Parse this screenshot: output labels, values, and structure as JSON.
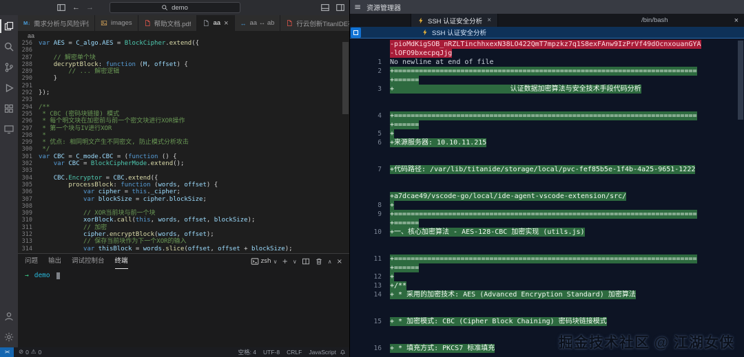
{
  "left_window": {
    "title_bar": {
      "command_center": "demo"
    },
    "activity_bar": {
      "top": [
        "files",
        "search",
        "source-control",
        "run-debug",
        "extensions",
        "remote"
      ],
      "bottom": [
        "account",
        "settings-gear"
      ]
    },
    "tabs": [
      {
        "label": "需求分析与风险评估.md",
        "icon": "markdown",
        "active": false
      },
      {
        "label": "images",
        "icon": "image",
        "active": false
      },
      {
        "label": "帮助文档.pdf",
        "icon": "pdf",
        "active": false
      },
      {
        "label": "aa",
        "icon": "file",
        "active": true
      },
      {
        "label": "aa ↔ ab",
        "icon": "diff",
        "active": false
      },
      {
        "label": "行云创新TitanIDE在数据要...",
        "icon": "pdf",
        "active": false
      }
    ],
    "breadcrumb": "aa",
    "editor_lines": [
      {
        "n": "256",
        "t": [
          [
            "kw",
            "var "
          ],
          [
            "vb",
            "AES"
          ],
          [
            "pl",
            " = "
          ],
          [
            "vb",
            "C_algo"
          ],
          [
            "pl",
            "."
          ],
          [
            "vb",
            "AES"
          ],
          [
            "pl",
            " = "
          ],
          [
            "cl",
            "BlockCipher"
          ],
          [
            "pl",
            "."
          ],
          [
            "fn",
            "extend"
          ],
          [
            "pl",
            "({"
          ]
        ]
      },
      {
        "n": "286",
        "t": []
      },
      {
        "n": "287",
        "t": [
          [
            "cm",
            "    // 解密单个块"
          ]
        ]
      },
      {
        "n": "288",
        "t": [
          [
            "pl",
            "    "
          ],
          [
            "fn",
            "decryptBlock"
          ],
          [
            "pl",
            ": "
          ],
          [
            "kw",
            "function"
          ],
          [
            "pl",
            " ("
          ],
          [
            "vb",
            "M"
          ],
          [
            "pl",
            ", "
          ],
          [
            "vb",
            "offset"
          ],
          [
            "pl",
            ") {"
          ]
        ]
      },
      {
        "n": "289",
        "t": [
          [
            "cm",
            "        // ... 解密逻辑"
          ]
        ]
      },
      {
        "n": "290",
        "t": [
          [
            "pl",
            "    }"
          ]
        ]
      },
      {
        "n": "291",
        "t": []
      },
      {
        "n": "292",
        "t": [
          [
            "pl",
            "});"
          ]
        ]
      },
      {
        "n": "293",
        "t": []
      },
      {
        "n": "294",
        "t": [
          [
            "cm",
            "/**"
          ]
        ]
      },
      {
        "n": "295",
        "t": [
          [
            "cm",
            " * CBC (密码块链接) 模式"
          ]
        ]
      },
      {
        "n": "296",
        "t": [
          [
            "cm",
            " * 每个明文块在加密前与前一个密文块进行XOR操作"
          ]
        ]
      },
      {
        "n": "297",
        "t": [
          [
            "cm",
            " * 第一个块与IV进行XOR"
          ]
        ]
      },
      {
        "n": "298",
        "t": [
          [
            "cm",
            " *"
          ]
        ]
      },
      {
        "n": "299",
        "t": [
          [
            "cm",
            " * 优点: 相同明文产生不同密文, 防止模式分析攻击"
          ]
        ]
      },
      {
        "n": "300",
        "t": [
          [
            "cm",
            " */"
          ]
        ]
      },
      {
        "n": "301",
        "t": [
          [
            "kw",
            "var "
          ],
          [
            "vb",
            "CBC"
          ],
          [
            "pl",
            " = "
          ],
          [
            "vb",
            "C_mode"
          ],
          [
            "pl",
            "."
          ],
          [
            "vb",
            "CBC"
          ],
          [
            "pl",
            " = ("
          ],
          [
            "kw",
            "function"
          ],
          [
            "pl",
            " () {"
          ]
        ]
      },
      {
        "n": "302",
        "t": [
          [
            "pl",
            "    "
          ],
          [
            "kw",
            "var "
          ],
          [
            "vb",
            "CBC"
          ],
          [
            "pl",
            " = "
          ],
          [
            "cl",
            "BlockCipherMode"
          ],
          [
            "pl",
            "."
          ],
          [
            "fn",
            "extend"
          ],
          [
            "pl",
            "();"
          ]
        ]
      },
      {
        "n": "303",
        "t": []
      },
      {
        "n": "304",
        "t": [
          [
            "pl",
            "    "
          ],
          [
            "vb",
            "CBC"
          ],
          [
            "pl",
            "."
          ],
          [
            "cl",
            "Encryptor"
          ],
          [
            "pl",
            " = "
          ],
          [
            "vb",
            "CBC"
          ],
          [
            "pl",
            "."
          ],
          [
            "fn",
            "extend"
          ],
          [
            "pl",
            "({"
          ]
        ]
      },
      {
        "n": "305",
        "t": [
          [
            "pl",
            "        "
          ],
          [
            "fn",
            "processBlock"
          ],
          [
            "pl",
            ": "
          ],
          [
            "kw",
            "function"
          ],
          [
            "pl",
            " ("
          ],
          [
            "vb",
            "words"
          ],
          [
            "pl",
            ", "
          ],
          [
            "vb",
            "offset"
          ],
          [
            "pl",
            ") {"
          ]
        ]
      },
      {
        "n": "306",
        "t": [
          [
            "pl",
            "            "
          ],
          [
            "kw",
            "var "
          ],
          [
            "vb",
            "cipher"
          ],
          [
            "pl",
            " = "
          ],
          [
            "kw",
            "this"
          ],
          [
            "pl",
            "."
          ],
          [
            "vb",
            "_cipher"
          ],
          [
            "pl",
            ";"
          ]
        ]
      },
      {
        "n": "307",
        "t": [
          [
            "pl",
            "            "
          ],
          [
            "kw",
            "var "
          ],
          [
            "vb",
            "blockSize"
          ],
          [
            "pl",
            " = "
          ],
          [
            "vb",
            "cipher"
          ],
          [
            "pl",
            "."
          ],
          [
            "vb",
            "blockSize"
          ],
          [
            "pl",
            ";"
          ]
        ]
      },
      {
        "n": "308",
        "t": []
      },
      {
        "n": "309",
        "t": [
          [
            "cm",
            "            // XOR当前块与前一个块"
          ]
        ]
      },
      {
        "n": "310",
        "t": [
          [
            "pl",
            "            "
          ],
          [
            "vb",
            "xorBlock"
          ],
          [
            "pl",
            "."
          ],
          [
            "fn",
            "call"
          ],
          [
            "pl",
            "("
          ],
          [
            "kw",
            "this"
          ],
          [
            "pl",
            ", "
          ],
          [
            "vb",
            "words"
          ],
          [
            "pl",
            ", "
          ],
          [
            "vb",
            "offset"
          ],
          [
            "pl",
            ", "
          ],
          [
            "vb",
            "blockSize"
          ],
          [
            "pl",
            ");"
          ]
        ]
      },
      {
        "n": "311",
        "t": [
          [
            "cm",
            "            // 加密"
          ]
        ]
      },
      {
        "n": "312",
        "t": [
          [
            "pl",
            "            "
          ],
          [
            "vb",
            "cipher"
          ],
          [
            "pl",
            "."
          ],
          [
            "fn",
            "encryptBlock"
          ],
          [
            "pl",
            "("
          ],
          [
            "vb",
            "words"
          ],
          [
            "pl",
            ", "
          ],
          [
            "vb",
            "offset"
          ],
          [
            "pl",
            ");"
          ]
        ]
      },
      {
        "n": "313",
        "t": [
          [
            "cm",
            "            // 保存当前块作为下一个XOR的输入"
          ]
        ]
      },
      {
        "n": "314",
        "t": [
          [
            "pl",
            "            "
          ],
          [
            "kw",
            "var "
          ],
          [
            "vb",
            "thisBlock"
          ],
          [
            "pl",
            " = "
          ],
          [
            "vb",
            "words"
          ],
          [
            "pl",
            "."
          ],
          [
            "fn",
            "slice"
          ],
          [
            "pl",
            "("
          ],
          [
            "vb",
            "offset"
          ],
          [
            "pl",
            ", "
          ],
          [
            "vb",
            "offset"
          ],
          [
            "pl",
            " + "
          ],
          [
            "vb",
            "blockSize"
          ],
          [
            "pl",
            ");"
          ]
        ]
      }
    ],
    "panel": {
      "tabs": [
        {
          "label": "问题",
          "active": false
        },
        {
          "label": "输出",
          "active": false
        },
        {
          "label": "调试控制台",
          "active": false
        },
        {
          "label": "终端",
          "active": true
        }
      ],
      "shell_selector": "zsh",
      "terminal_prompt": "→",
      "terminal_cwd": "demo"
    },
    "status_bar": {
      "errors": "0",
      "warnings": "0",
      "right_items": [
        "空格: 4",
        "UTF-8",
        "CRLF",
        "JavaScript"
      ]
    }
  },
  "right_window": {
    "menu_title": "资源管理器",
    "editor_tab": {
      "label": "SSH 认证安全分析",
      "shell": "/bin/bash"
    },
    "terminal_tab": {
      "label": "SSH 认证安全分析"
    },
    "diff_rows": [
      {
        "n": "",
        "type": "del",
        "text": "-pioMdKigSOB_nRZLTinchhxexN38LO422QmT7mpzkz7q1S8exFAnw9IzPrVf49dOcnxouanGYA"
      },
      {
        "n": "",
        "type": "del",
        "text": "-lOFO9bxecpqJjg"
      },
      {
        "n": "1",
        "type": "plain",
        "text": "No newline at end of file"
      },
      {
        "n": "2",
        "type": "add",
        "text": "+========================================================================="
      },
      {
        "n": "",
        "type": "add",
        "text": "+======"
      },
      {
        "n": "3",
        "type": "add",
        "text": "+                            认证数据加密算法与安全技术手段代码分析"
      },
      {
        "n": "",
        "type": "gap",
        "text": ""
      },
      {
        "n": "",
        "type": "gap",
        "text": ""
      },
      {
        "n": "4",
        "type": "add",
        "text": "+========================================================================="
      },
      {
        "n": "",
        "type": "add",
        "text": "+======"
      },
      {
        "n": "5",
        "type": "add",
        "text": "+"
      },
      {
        "n": "6",
        "type": "add",
        "text": "+来源服务器: 10.10.11.215"
      },
      {
        "n": "",
        "type": "gap",
        "text": ""
      },
      {
        "n": "",
        "type": "gap",
        "text": ""
      },
      {
        "n": "7",
        "type": "add",
        "text": "+代码路径: /var/lib/titanide/storage/local/pvc-fef85b5e-1f4b-4a25-9651-1222"
      },
      {
        "n": "",
        "type": "gap",
        "text": ""
      },
      {
        "n": "",
        "type": "gap",
        "text": ""
      },
      {
        "n": "",
        "type": "add",
        "text": "+a7dcae49/vscode-go/local/ide-agent-vscode-extension/src/"
      },
      {
        "n": "8",
        "type": "add",
        "text": "+"
      },
      {
        "n": "9",
        "type": "add",
        "text": "+========================================================================="
      },
      {
        "n": "",
        "type": "add",
        "text": "+======"
      },
      {
        "n": "10",
        "type": "add",
        "text": "+一、核心加密算法 - AES-128-CBC 加密实现 (utils.js)"
      },
      {
        "n": "",
        "type": "gap",
        "text": ""
      },
      {
        "n": "",
        "type": "gap",
        "text": ""
      },
      {
        "n": "11",
        "type": "add",
        "text": "+========================================================================="
      },
      {
        "n": "",
        "type": "add",
        "text": "+======"
      },
      {
        "n": "12",
        "type": "add",
        "text": "+"
      },
      {
        "n": "13",
        "type": "add",
        "text": "+/**"
      },
      {
        "n": "14",
        "type": "add",
        "text": "+ * 采用的加密技术: AES (Advanced Encryption Standard) 加密算法"
      },
      {
        "n": "",
        "type": "gap",
        "text": ""
      },
      {
        "n": "",
        "type": "gap",
        "text": ""
      },
      {
        "n": "15",
        "type": "add",
        "text": "+ * 加密模式: CBC (Cipher Block Chaining) 密码块链接模式"
      },
      {
        "n": "",
        "type": "gap",
        "text": ""
      },
      {
        "n": "",
        "type": "gap",
        "text": ""
      },
      {
        "n": "16",
        "type": "add",
        "text": "+ * 填充方式: PKCS7 标准填充"
      }
    ],
    "watermark": "掘金技术社区 @ 江湖女侠"
  },
  "colors": {
    "addition_bg": "#2d6a3f",
    "deletion_bg": "#a81c38",
    "accent_blue": "#1273d4",
    "terminal_green": "#3dd68c",
    "terminal_cyan": "#29b8db"
  }
}
